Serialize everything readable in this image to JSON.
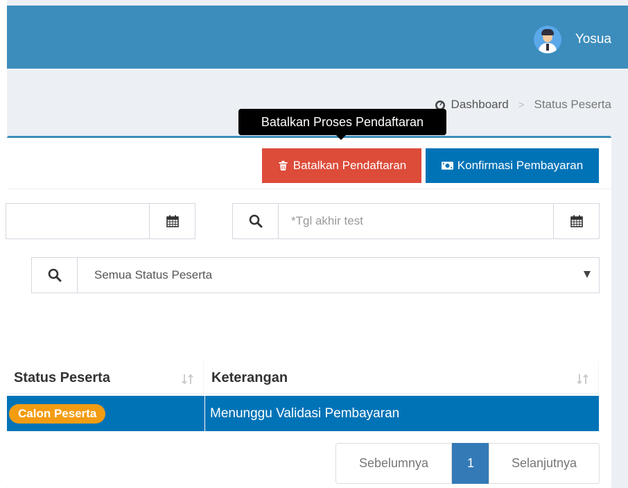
{
  "header": {
    "username": "Yosua",
    "avatar_icon": "user-avatar-icon",
    "color": "#3c8dbc"
  },
  "breadcrumb": {
    "home_icon": "dashboard-icon",
    "home_label": "Dashboard",
    "separator": ">",
    "current": "Status Peserta"
  },
  "tooltip": {
    "text": "Batalkan Proses Pendaftaran"
  },
  "toolbar": {
    "cancel_label": "Batalkan Pendaftaran",
    "cancel_icon": "trash-icon",
    "cancel_color": "#dd4b39",
    "confirm_label": "Konfirmasi Pembayaran",
    "confirm_icon": "money-icon",
    "confirm_color": "#0073b7"
  },
  "filters": {
    "start_date_placeholder": "",
    "end_date_placeholder": "*Tgl akhir test",
    "status_selected": "Semua Status Peserta"
  },
  "table": {
    "columns": [
      "Status Peserta",
      "Keterangan"
    ],
    "rows": [
      {
        "status": "Calon Peserta",
        "keterangan": "Menunggu Validasi Pembayaran"
      }
    ],
    "selected_row_color": "#0073b7",
    "badge_color": "#f39c12"
  },
  "pagination": {
    "prev_label": "Sebelumnya",
    "current_page": "1",
    "next_label": "Selanjutnya"
  }
}
